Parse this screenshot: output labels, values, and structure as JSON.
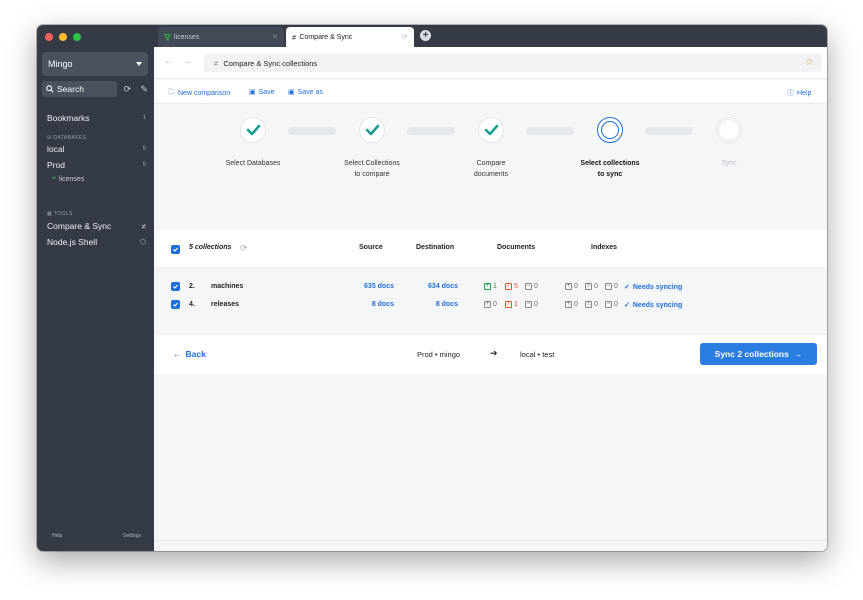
{
  "sidebar": {
    "connection": "Mingo",
    "search_label": "Search",
    "bookmarks": {
      "label": "Bookmarks",
      "count": "1"
    },
    "databases_header": "DATABASES",
    "databases": [
      {
        "label": "local",
        "count": "5"
      },
      {
        "label": "Prod",
        "count": "5"
      }
    ],
    "sub_item": "licenses",
    "tools_header": "TOOLS",
    "tools": [
      {
        "label": "Compare & Sync"
      },
      {
        "label": "Node.js Shell"
      }
    ],
    "footer": {
      "help": "Help",
      "settings": "Settings"
    }
  },
  "tabs": [
    {
      "label": "licenses",
      "active": false
    },
    {
      "label": "Compare & Sync",
      "active": true
    }
  ],
  "urlbar": {
    "text": "Compare & Sync collections"
  },
  "toolbar": {
    "new_comparison": "New comparison",
    "save": "Save",
    "save_as": "Save as",
    "help": "Help"
  },
  "steps": [
    {
      "line1": "Select Databases",
      "line2": "",
      "state": "done"
    },
    {
      "line1": "Select Collections",
      "line2": "to compare",
      "state": "done"
    },
    {
      "line1": "Compare",
      "line2": "documents",
      "state": "done"
    },
    {
      "line1": "Select collections",
      "line2": "to sync",
      "state": "current"
    },
    {
      "line1": "Sync",
      "line2": "",
      "state": "todo"
    }
  ],
  "table": {
    "count_label": "5 collections",
    "headers": {
      "source": "Source",
      "destination": "Destination",
      "documents": "Documents",
      "indexes": "Indexes"
    },
    "rows": [
      {
        "num": "2.",
        "name": "machines",
        "source": "635 docs",
        "destination": "634 docs",
        "doc_added": "1",
        "doc_changed": "5",
        "doc_removed": "0",
        "idx_added": "0",
        "idx_changed": "0",
        "idx_removed": "0",
        "status": "Needs syncing"
      },
      {
        "num": "4.",
        "name": "releases",
        "source": "8 docs",
        "destination": "8 docs",
        "doc_added": "0",
        "doc_changed": "1",
        "doc_removed": "0",
        "idx_added": "0",
        "idx_changed": "0",
        "idx_removed": "0",
        "status": "Needs syncing"
      }
    ]
  },
  "footer": {
    "back": "Back",
    "from": "Prod • mingo",
    "to": "local • test",
    "sync_button": "Sync 2 collections"
  },
  "colors": {
    "accent": "#1e6fd9",
    "sidebar": "#343b47",
    "success": "#1a9e48",
    "warning": "#e2542e"
  }
}
